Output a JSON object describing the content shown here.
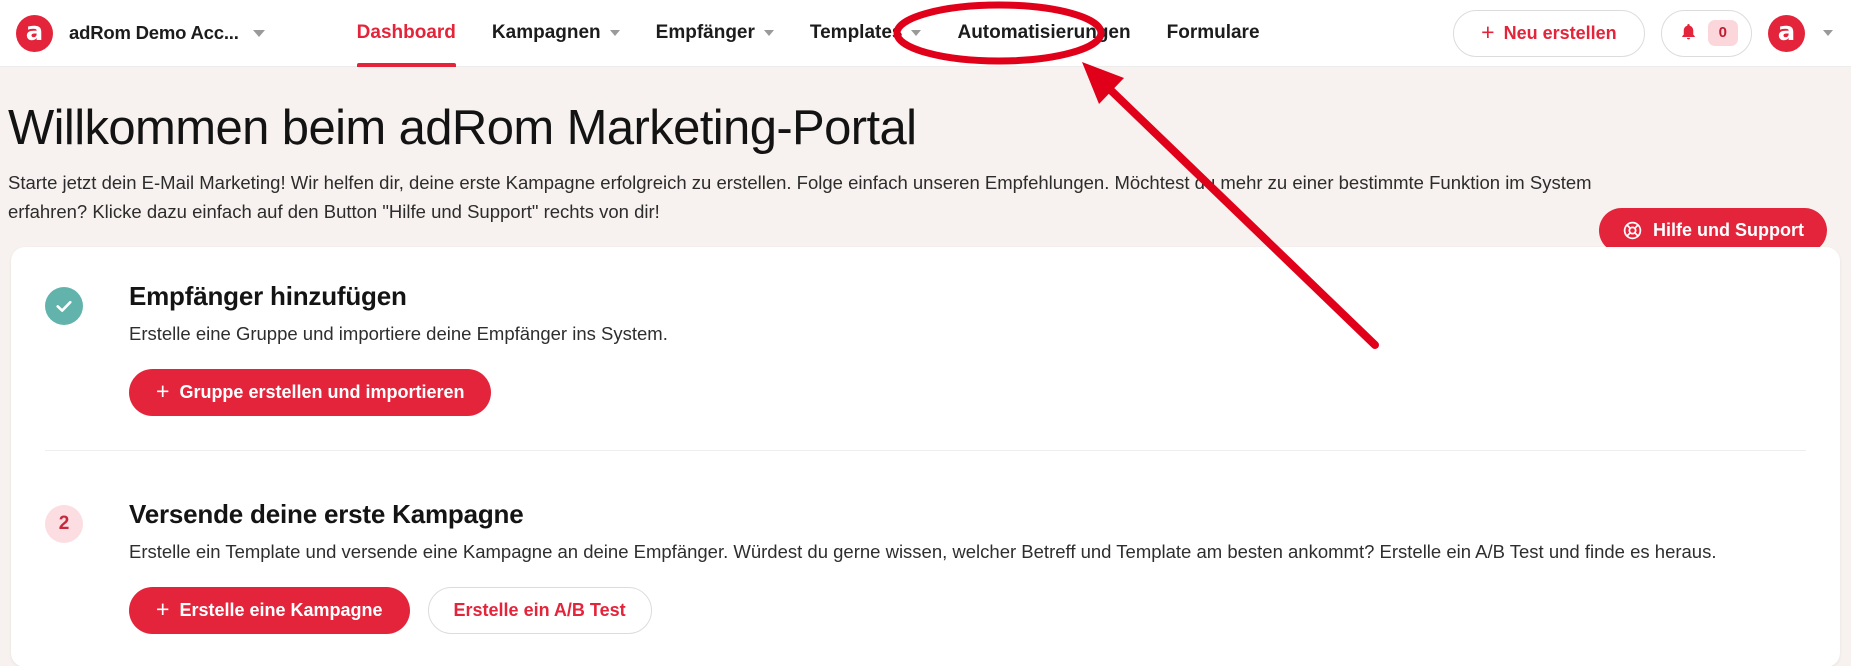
{
  "header": {
    "logo_letter": "a",
    "account_name": "adRom Demo Acc...",
    "account_caret": "chevron-down",
    "nav": [
      {
        "label": "Dashboard",
        "active": true,
        "has_caret": false
      },
      {
        "label": "Kampagnen",
        "active": false,
        "has_caret": true
      },
      {
        "label": "Empfänger",
        "active": false,
        "has_caret": true
      },
      {
        "label": "Templates",
        "active": false,
        "has_caret": true
      },
      {
        "label": "Automatisierungen",
        "active": false,
        "has_caret": false
      },
      {
        "label": "Formulare",
        "active": false,
        "has_caret": false
      }
    ],
    "new_button": {
      "plus": "+",
      "label": "Neu erstellen"
    },
    "notifications": {
      "icon": "bell-icon",
      "count": "0"
    },
    "avatar_letter": "a"
  },
  "hero": {
    "title": "Willkommen beim adRom Marketing-Portal",
    "description": "Starte jetzt dein E-Mail Marketing! Wir helfen dir, deine erste Kampagne erfolgreich zu erstellen. Folge einfach unseren Empfehlungen. Möchtest du mehr zu einer bestimmte Funktion im System erfahren? Klicke dazu einfach auf den Button \"Hilfe und Support\" rechts von dir!",
    "help_button": "Hilfe und Support"
  },
  "steps": [
    {
      "marker": "check",
      "title": "Empfänger hinzufügen",
      "description": "Erstelle eine Gruppe und importiere deine Empfänger ins System.",
      "primary_button": {
        "plus": "+",
        "label": "Gruppe erstellen und importieren"
      }
    },
    {
      "marker": "2",
      "title": "Versende deine erste Kampagne",
      "description": "Erstelle ein Template und versende eine Kampagne an deine Empfänger. Würdest du gerne wissen, welcher Betreff und Template am besten ankommt? Erstelle ein A/B Test und finde es heraus.",
      "primary_button": {
        "plus": "+",
        "label": "Erstelle eine Kampagne"
      },
      "secondary_button": {
        "label": "Erstelle ein A/B Test"
      }
    }
  ],
  "annotation": {
    "type": "ellipse-and-arrow",
    "target": "Automatisierungen",
    "color": "#E1001A"
  },
  "colors": {
    "brand_red": "#E3243A",
    "annotation_red": "#E1001A",
    "hero_background": "#f7f2ef",
    "check_teal": "#62B3AC",
    "badge_pink": "#FBDDE2",
    "badge_text": "#C6283C"
  }
}
